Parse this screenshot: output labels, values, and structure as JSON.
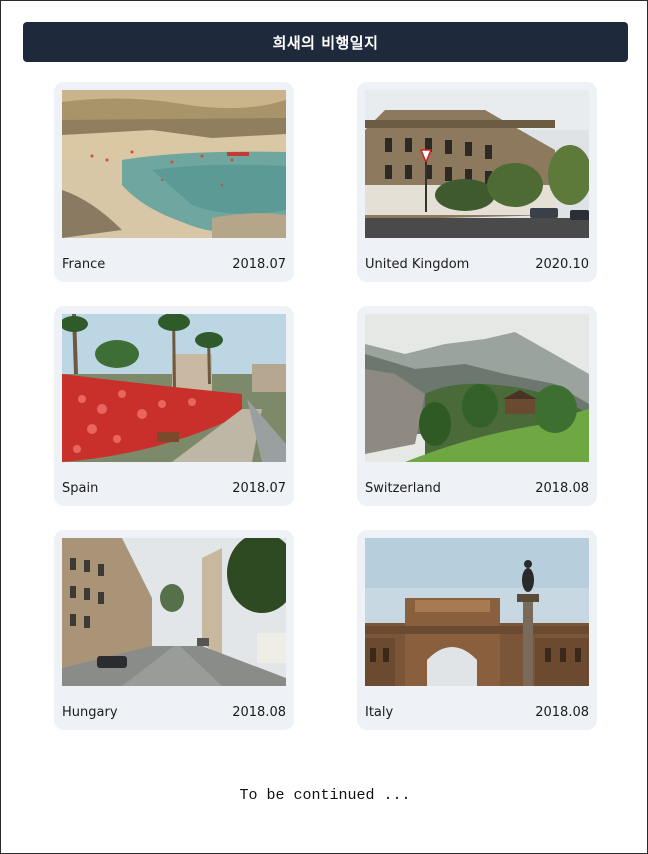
{
  "header": {
    "title": "희새의 비행일지"
  },
  "cards": [
    {
      "country": "France",
      "date": "2018.07",
      "photo": "beach-cove-photo"
    },
    {
      "country": "United Kingdom",
      "date": "2020.10",
      "photo": "street-terrace-photo"
    },
    {
      "country": "Spain",
      "date": "2018.07",
      "photo": "flower-promenade-photo"
    },
    {
      "country": "Switzerland",
      "date": "2018.08",
      "photo": "alpine-meadow-photo"
    },
    {
      "country": "Hungary",
      "date": "2018.08",
      "photo": "city-avenue-photo"
    },
    {
      "country": "Italy",
      "date": "2018.08",
      "photo": "arch-monument-photo"
    }
  ],
  "footer": {
    "text": "To be continued ..."
  },
  "colors": {
    "header_bg": "#1e293b",
    "card_bg": "#eef2f7"
  }
}
